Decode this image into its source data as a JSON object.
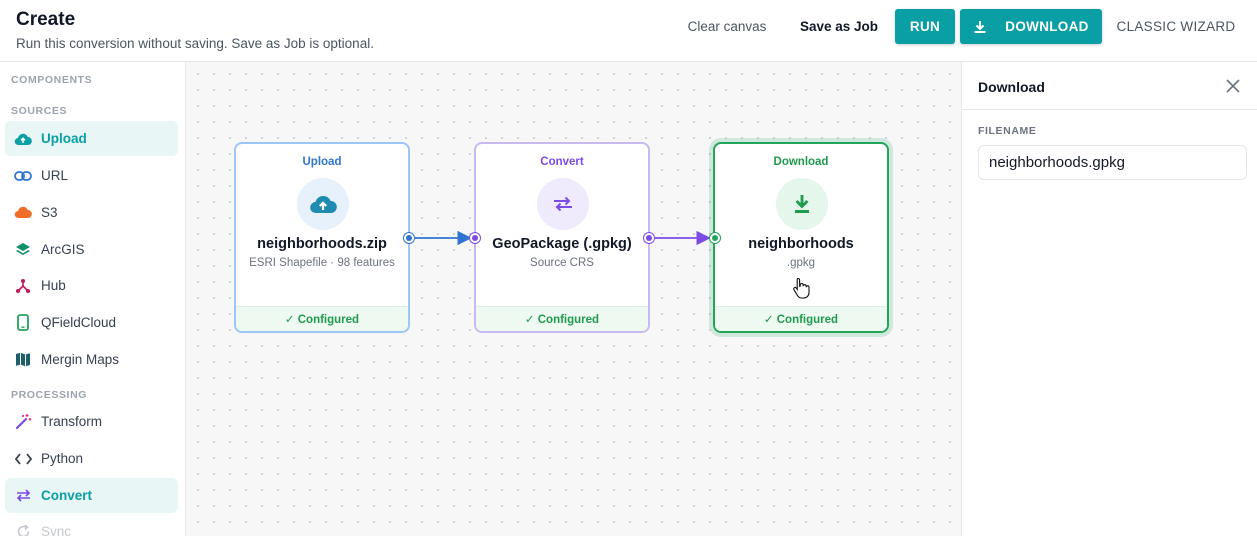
{
  "header": {
    "title": "Create",
    "subtitle": "Run this conversion without saving. Save as Job is optional.",
    "clear_label": "Clear canvas",
    "save_label": "Save as Job",
    "run_label": "RUN",
    "download_label": "DOWNLOAD",
    "wizard_label": "CLASSIC WIZARD"
  },
  "sidebar": {
    "components_label": "COMPONENTS",
    "sources_label": "SOURCES",
    "processing_label": "PROCESSING",
    "sources": [
      {
        "label": "Upload",
        "icon": "cloud-upload-icon",
        "active": true
      },
      {
        "label": "URL",
        "icon": "link-icon"
      },
      {
        "label": "S3",
        "icon": "cloud-icon"
      },
      {
        "label": "ArcGIS",
        "icon": "layers-icon"
      },
      {
        "label": "Hub",
        "icon": "hub-icon"
      },
      {
        "label": "QFieldCloud",
        "icon": "phone-icon"
      },
      {
        "label": "Mergin Maps",
        "icon": "map-icon"
      }
    ],
    "processing": [
      {
        "label": "Transform",
        "icon": "magic-wand-icon"
      },
      {
        "label": "Python",
        "icon": "code-icon"
      },
      {
        "label": "Convert",
        "icon": "swap-icon",
        "active": true
      },
      {
        "label": "Sync",
        "icon": "sync-icon",
        "faded": true
      }
    ]
  },
  "canvas": {
    "nodes": [
      {
        "type": "Upload",
        "name": "neighborhoods.zip",
        "sub": "ESRI Shapefile · 98 features",
        "status": "✓ Configured"
      },
      {
        "type": "Convert",
        "name": "GeoPackage (.gpkg)",
        "sub": "Source CRS",
        "status": "✓ Configured"
      },
      {
        "type": "Download",
        "name": "neighborhoods",
        "sub": ".gpkg",
        "status": "✓ Configured"
      }
    ]
  },
  "panel": {
    "title": "Download",
    "filename_label": "FILENAME",
    "filename_value": "neighborhoods.gpkg"
  },
  "colors": {
    "accent": "#0a9ea5",
    "upload": "#2f74d0",
    "convert": "#7c4be6",
    "download": "#22a55a"
  }
}
